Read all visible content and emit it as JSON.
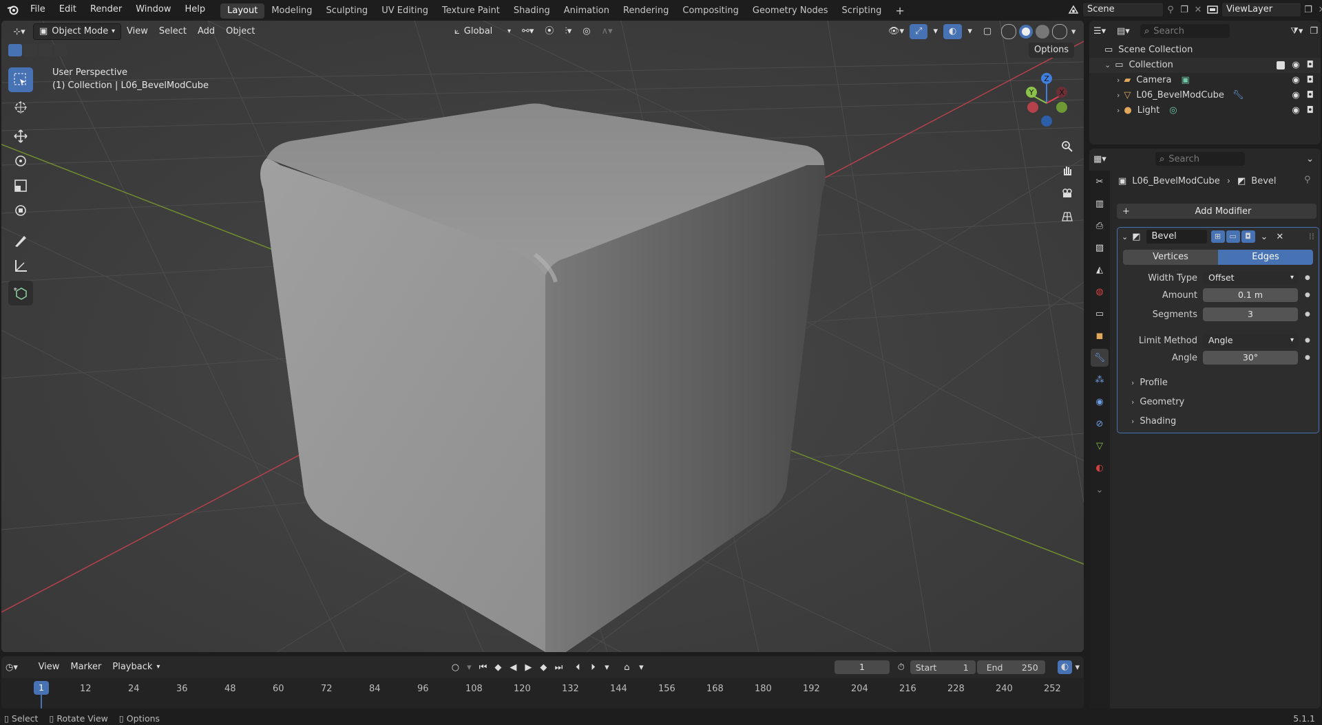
{
  "topbar": {
    "menus": [
      "File",
      "Edit",
      "Render",
      "Window",
      "Help"
    ],
    "workspaces": [
      "Layout",
      "Modeling",
      "Sculpting",
      "UV Editing",
      "Texture Paint",
      "Shading",
      "Animation",
      "Rendering",
      "Compositing",
      "Geometry Nodes",
      "Scripting"
    ],
    "active_workspace": "Layout",
    "scene_name": "Scene",
    "view_layer": "ViewLayer"
  },
  "viewport_header": {
    "mode": "Object Mode",
    "menus": [
      "View",
      "Select",
      "Add",
      "Object"
    ],
    "orientation": "Global",
    "options": "Options"
  },
  "viewport": {
    "perspective": "User Perspective",
    "collection_info": "(1) Collection | L06_BevelModCube",
    "gizmo": {
      "x": "X",
      "y": "Y",
      "z": "Z"
    }
  },
  "outliner": {
    "search_placeholder": "Search",
    "root": "Scene Collection",
    "collection": "Collection",
    "items": [
      "Camera",
      "L06_BevelModCube",
      "Light"
    ]
  },
  "properties": {
    "search_placeholder": "Search",
    "breadcrumb_object": "L06_BevelModCube",
    "breadcrumb_modifier": "Bevel",
    "add_modifier": "Add Modifier",
    "modifier": {
      "name": "Bevel",
      "affect_options": [
        "Vertices",
        "Edges"
      ],
      "affect_selected": "Edges",
      "width_type_label": "Width Type",
      "width_type": "Offset",
      "amount_label": "Amount",
      "amount": "0.1 m",
      "segments_label": "Segments",
      "segments": "3",
      "limit_method_label": "Limit Method",
      "limit_method": "Angle",
      "angle_label": "Angle",
      "angle": "30°",
      "subpanels": [
        "Profile",
        "Geometry",
        "Shading"
      ]
    }
  },
  "timeline": {
    "menus": [
      "View",
      "Marker",
      "Playback"
    ],
    "current_frame": "1",
    "start_label": "Start",
    "start": "1",
    "end_label": "End",
    "end": "250",
    "ticks": [
      "12",
      "24",
      "36",
      "48",
      "60",
      "72",
      "84",
      "96",
      "108",
      "120",
      "132",
      "144",
      "156",
      "168",
      "180",
      "192",
      "204",
      "216",
      "228",
      "240",
      "252"
    ],
    "playhead": "1"
  },
  "statusbar": {
    "items": [
      "Select",
      "Rotate View",
      "Options"
    ],
    "version": "5.1.1"
  },
  "colors": {
    "accent": "#4772b3",
    "x_axis": "#e0404e",
    "y_axis": "#8bc34a",
    "z_axis": "#3f7fe0"
  }
}
